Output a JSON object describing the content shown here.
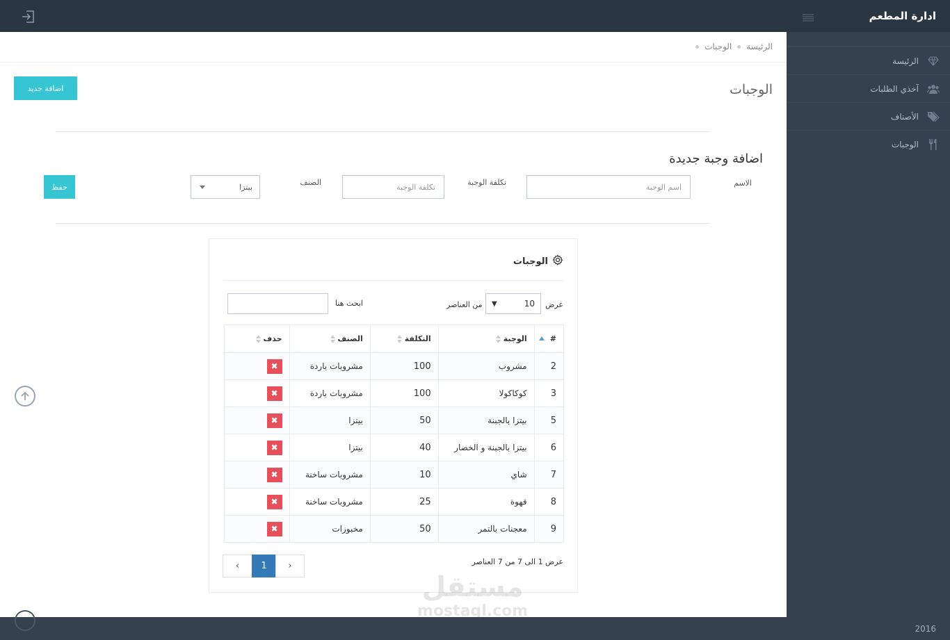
{
  "app": {
    "title": "ادارة المطعم",
    "year": "2016"
  },
  "sidebar": {
    "items": [
      {
        "label": "الرئيسة",
        "icon": "diamond-icon"
      },
      {
        "label": "آخذي الطلبات",
        "icon": "users-icon"
      },
      {
        "label": "الأصناف",
        "icon": "tags-icon"
      },
      {
        "label": "الوجبات",
        "icon": "cutlery-icon"
      }
    ]
  },
  "breadcrumb": {
    "home": "الرئيسة",
    "current": "الوجبات"
  },
  "page": {
    "title": "الوجبات",
    "add_new_label": "اضافة جديد"
  },
  "form": {
    "title": "اضافة وجبة جديدة",
    "name_label": "الاسم",
    "name_placeholder": "اسم الوجبة",
    "cost_label": "تكلفة الوجبة",
    "cost_placeholder": "تكلفة الوجبة",
    "category_label": "الصنف",
    "category_value": "بيتزا",
    "save_label": "حفظ"
  },
  "portlet": {
    "title": "الوجبات",
    "length_prefix": "عرض",
    "length_value": "10",
    "length_suffix": "من العناصر",
    "search_label": "ابحث هنا",
    "headers": {
      "id": "#",
      "meal": "الوجبة",
      "cost": "التكلفة",
      "category": "الصنف",
      "delete": "حذف"
    },
    "rows": [
      {
        "id": "2",
        "meal": "مشروب",
        "cost": "100",
        "category": "مشروبات باردة"
      },
      {
        "id": "3",
        "meal": "كوكاكولا",
        "cost": "100",
        "category": "مشروبات باردة"
      },
      {
        "id": "5",
        "meal": "بيتزا بالجبنة",
        "cost": "50",
        "category": "بيتزا"
      },
      {
        "id": "6",
        "meal": "بيتزا بالجبنة و الخضار",
        "cost": "40",
        "category": "بيتزا"
      },
      {
        "id": "7",
        "meal": "شاي",
        "cost": "10",
        "category": "مشروبات ساخنة"
      },
      {
        "id": "8",
        "meal": "قهوة",
        "cost": "25",
        "category": "مشروبات ساخنة"
      },
      {
        "id": "9",
        "meal": "معجنات بالتمر",
        "cost": "50",
        "category": "مخبوزات"
      }
    ],
    "info": "عرض 1 الى 7 من 7 العناصر",
    "pagination": {
      "prev": "‹",
      "current": "1",
      "next": "›"
    }
  },
  "watermark": {
    "arabic": "مستقل",
    "latin": "mostaql.com"
  },
  "colors": {
    "topbar": "#2b3643",
    "sidebar": "#364150",
    "accent": "#36c6d3",
    "danger": "#e7505a",
    "primary": "#337ab7"
  }
}
